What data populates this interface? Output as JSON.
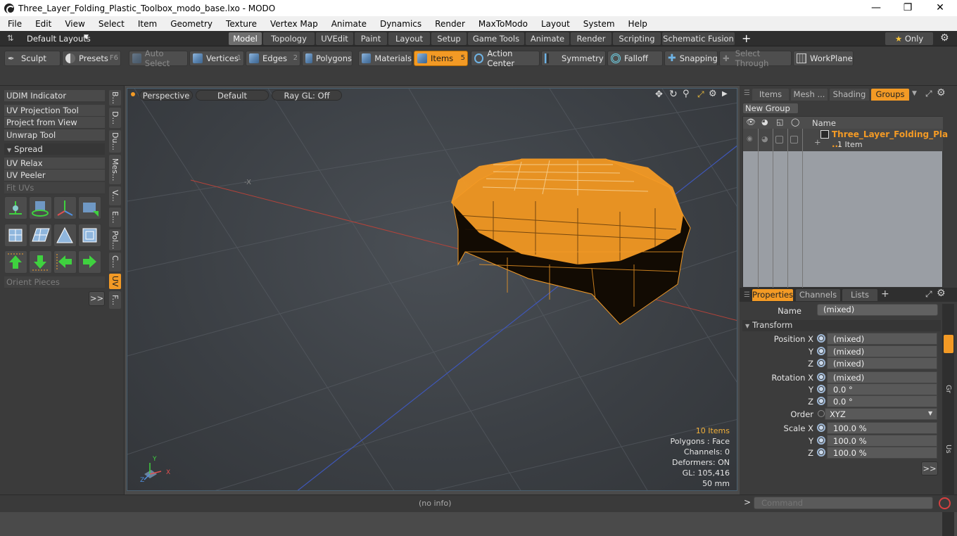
{
  "window": {
    "title": "Three_Layer_Folding_Plastic_Toolbox_modo_base.lxo - MODO"
  },
  "menu": [
    "File",
    "Edit",
    "View",
    "Select",
    "Item",
    "Geometry",
    "Texture",
    "Vertex Map",
    "Animate",
    "Dynamics",
    "Render",
    "MaxToModo",
    "Layout",
    "System",
    "Help"
  ],
  "layouts": {
    "default_label": "Default Layouts",
    "tabs": [
      "Model",
      "Topology",
      "UVEdit",
      "Paint",
      "Layout",
      "Setup",
      "Game Tools",
      "Animate",
      "Render",
      "Scripting",
      "Schematic Fusion"
    ],
    "only_label": "Only"
  },
  "toolbar": {
    "sculpt": "Sculpt",
    "presets": "Presets",
    "presets_key": "F6",
    "auto_select": "Auto Select",
    "vertices": "Vertices",
    "vertices_key": "1",
    "edges": "Edges",
    "edges_key": "2",
    "polygons": "Polygons",
    "materials": "Materials",
    "items": "Items",
    "items_key": "5",
    "action_center": "Action Center",
    "symmetry": "Symmetry",
    "falloff": "Falloff",
    "snapping": "Snapping",
    "select_through": "Select Through",
    "workplane": "WorkPlane"
  },
  "leftpanel": {
    "udim": "UDIM Indicator",
    "uv_projection": "UV Projection Tool",
    "project_from_view": "Project from View",
    "unwrap": "Unwrap Tool",
    "spread": "Spread",
    "uv_relax": "UV Relax",
    "uv_peeler": "UV Peeler",
    "fit_uvs": "Fit UVs",
    "orient_pieces": "Orient Pieces",
    "more": ">>",
    "vtabs": [
      "B...",
      "D...",
      "Du...",
      "Mes...",
      "V...",
      "E...",
      "Pol...",
      "C...",
      "UV",
      "F..."
    ]
  },
  "viewport": {
    "perspective": "Perspective",
    "default": "Default",
    "raygl": "Ray GL: Off",
    "neg_x": "-X",
    "stats": {
      "items": "10 Items",
      "polygons": "Polygons : Face",
      "channels": "Channels: 0",
      "deformers": "Deformers: ON",
      "gl": "GL: 105,416",
      "size": "50 mm"
    },
    "axis_x": "X",
    "axis_y": "Y",
    "axis_z": "Z"
  },
  "groups": {
    "tabs": [
      "Items",
      "Mesh ...",
      "Shading",
      "Groups"
    ],
    "new_group": "New Group",
    "col_name": "Name",
    "item_name": "Three_Layer_Folding_Pla ...",
    "item_count": "1 Item"
  },
  "properties": {
    "tabs": [
      "Properties",
      "Channels",
      "Lists"
    ],
    "name_label": "Name",
    "name_value": "(mixed)",
    "transform": "Transform",
    "rows": [
      {
        "label": "Position X",
        "value": "(mixed)"
      },
      {
        "label": "Y",
        "value": "(mixed)"
      },
      {
        "label": "Z",
        "value": "(mixed)"
      },
      {
        "label": "Rotation X",
        "value": "(mixed)"
      },
      {
        "label": "Y",
        "value": "0.0 °"
      },
      {
        "label": "Z",
        "value": "0.0 °"
      },
      {
        "label": "Order",
        "value": "XYZ"
      },
      {
        "label": "Scale X",
        "value": "100.0 %"
      },
      {
        "label": "Y",
        "value": "100.0 %"
      },
      {
        "label": "Z",
        "value": "100.0 %"
      }
    ],
    "side_tabs": [
      "Gr",
      "Us"
    ],
    "more": ">>"
  },
  "status": {
    "info": "(no info)",
    "command_placeholder": "Command"
  },
  "colors": {
    "accent": "#f39a25",
    "bg": "#3c3c3c"
  }
}
